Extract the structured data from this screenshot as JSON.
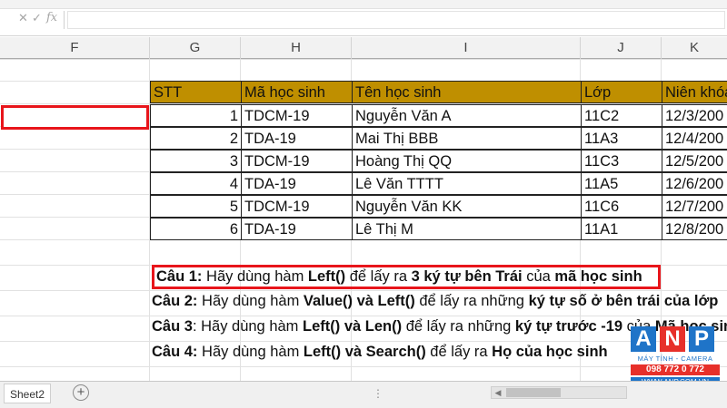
{
  "formula_bar": {
    "cancel_icon": "x-icon",
    "enter_icon": "check-icon",
    "fx_label": "fx",
    "content": ""
  },
  "columns": [
    "F",
    "G",
    "H",
    "I",
    "J",
    "K"
  ],
  "table": {
    "headers": [
      "STT",
      "Mã học sinh",
      "Tên học sinh",
      "Lớp",
      "Niên khóa"
    ],
    "rows": [
      [
        "1",
        "TDCM-19",
        "Nguyễn Văn A",
        "11C2",
        "12/3/200"
      ],
      [
        "2",
        "TDA-19",
        "Mai Thị BBB",
        "11A3",
        "12/4/200"
      ],
      [
        "3",
        "TDCM-19",
        "Hoàng Thị QQ",
        "11C3",
        "12/5/200"
      ],
      [
        "4",
        "TDA-19",
        "Lê Văn TTTT",
        "11A5",
        "12/6/200"
      ],
      [
        "5",
        "TDCM-19",
        "Nguyễn Văn KK",
        "11C6",
        "12/7/200"
      ],
      [
        "6",
        "TDA-19",
        "Lê Thị M",
        "11A1",
        "12/8/200"
      ]
    ],
    "header_color": "#bf8f00"
  },
  "questions": [
    {
      "id": "q1",
      "parts": [
        {
          "t": "Câu 1:",
          "b": true
        },
        {
          "t": " Hãy dùng hàm ",
          "b": false
        },
        {
          "t": "Left()",
          "b": true
        },
        {
          "t": " để lấy ra ",
          "b": false
        },
        {
          "t": "3 ký tự bên Trái",
          "b": true
        },
        {
          "t": " của ",
          "b": false
        },
        {
          "t": "mã học sinh",
          "b": true
        }
      ]
    },
    {
      "id": "q2",
      "parts": [
        {
          "t": "Câu 2:",
          "b": true
        },
        {
          "t": " Hãy dùng hàm ",
          "b": false
        },
        {
          "t": "Value() và Left()",
          "b": true
        },
        {
          "t": " để lấy ra những ",
          "b": false
        },
        {
          "t": "ký tự số ở bên trái của lớp",
          "b": true
        }
      ]
    },
    {
      "id": "q3",
      "parts": [
        {
          "t": "Câu 3",
          "b": true
        },
        {
          "t": ": Hãy dùng hàm ",
          "b": false
        },
        {
          "t": "Left() và Len()",
          "b": true
        },
        {
          "t": " để lấy ra  những ",
          "b": false
        },
        {
          "t": "ký tự trước -19",
          "b": true
        },
        {
          "t": " của ",
          "b": false
        },
        {
          "t": "Mã học sinh",
          "b": true
        }
      ]
    },
    {
      "id": "q4",
      "parts": [
        {
          "t": "Câu 4:",
          "b": true
        },
        {
          "t": " Hãy dùng hàm ",
          "b": false
        },
        {
          "t": "Left() và Search()",
          "b": true
        },
        {
          "t": " để lấy ra ",
          "b": false
        },
        {
          "t": "Họ của học sinh",
          "b": true
        }
      ]
    }
  ],
  "highlight_color": "#e8151b",
  "sheet_bar": {
    "active_tab": "Sheet2",
    "add_icon": "plus-circle-icon",
    "dots": "⋮"
  },
  "logo": {
    "letters": [
      "A",
      "N",
      "P"
    ],
    "tagline": "MÁY TÍNH - CAMERA",
    "phone": "098 772 0 772",
    "url": "WWW.ANP.COM.VN"
  }
}
